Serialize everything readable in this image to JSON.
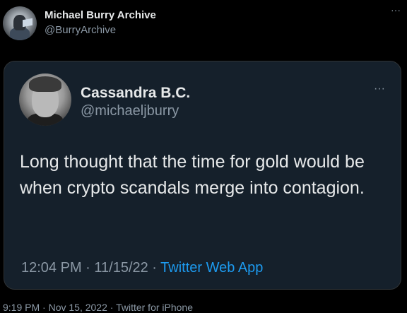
{
  "outer_tweet": {
    "name": "Michael Burry Archive",
    "handle": "@BurryArchive",
    "more_icon": "ellipsis-icon",
    "more_glyph": "···",
    "timestamp": "9:19 PM · Nov 15, 2022 · ",
    "source": "Twitter for iPhone"
  },
  "quoted_tweet": {
    "name": "Cassandra B.C.",
    "handle": "@michaeljburry",
    "more_icon": "ellipsis-icon",
    "more_glyph": "···",
    "text": "Long thought that the time for gold would be when crypto scandals merge into contagion.",
    "timestamp": "12:04 PM · 11/15/22 · ",
    "source": "Twitter Web App"
  },
  "colors": {
    "background": "#000000",
    "card_background": "#15202b",
    "primary_text": "#e7e9ea",
    "secondary_text": "#8b98a5",
    "link": "#1d9bf0"
  }
}
